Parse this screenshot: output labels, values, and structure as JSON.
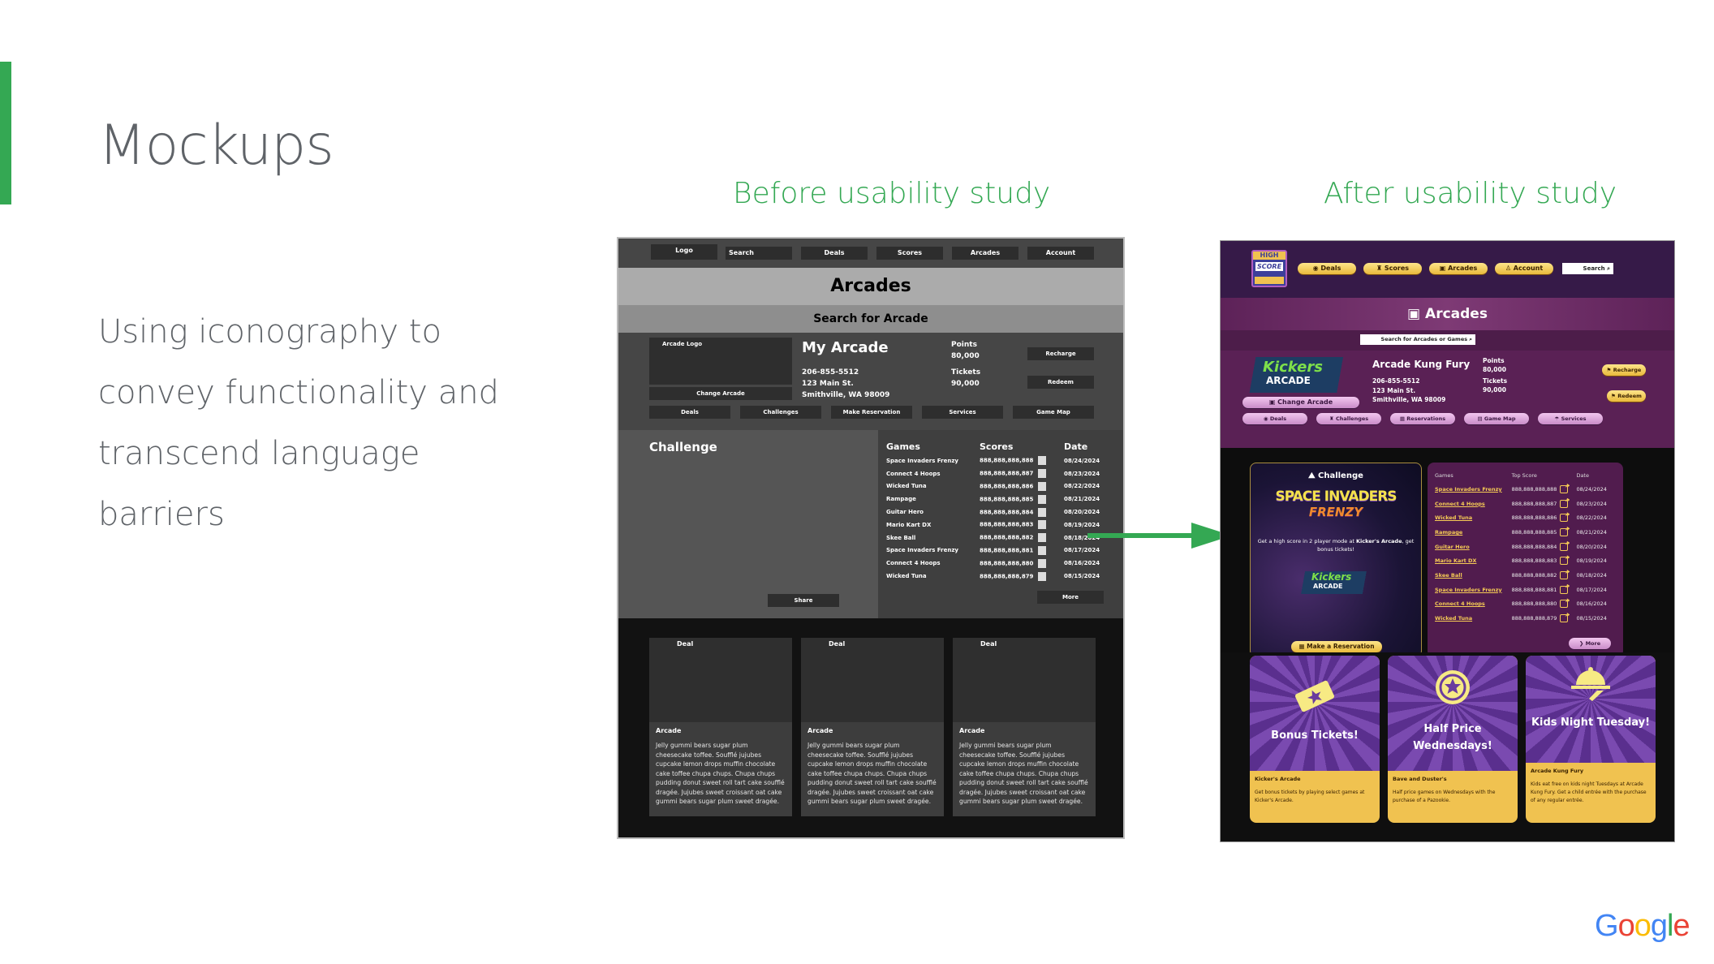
{
  "slide": {
    "title": "Mockups",
    "body": "Using iconography to convey functionality and transcend language barriers",
    "before_heading": "Before usability study",
    "after_heading": "After usability study",
    "brand_logo": "Google",
    "accent_color": "#34a853"
  },
  "before": {
    "nav": {
      "logo": "Logo",
      "search": "Search",
      "deals": "Deals",
      "scores": "Scores",
      "arcades": "Arcades",
      "account": "Account"
    },
    "title": "Arcades",
    "search_label": "Search for Arcade",
    "arcade": {
      "logo_label": "Arcade Logo",
      "change_button": "Change Arcade",
      "name": "My Arcade",
      "phone": "206-855-5512",
      "street": "123 Main St.",
      "city": "Smithville, WA 98009",
      "points_label": "Points",
      "points": "80,000",
      "tickets_label": "Tickets",
      "tickets": "90,000",
      "recharge": "Recharge",
      "redeem": "Redeem"
    },
    "actions": [
      "Deals",
      "Challenges",
      "Make Reservation",
      "Services",
      "Game Map"
    ],
    "challenge": {
      "title": "Challenge",
      "share": "Share"
    },
    "scores": {
      "headers": [
        "Games",
        "Scores",
        "Date"
      ],
      "rows": [
        [
          "Space Invaders Frenzy",
          "888,888,888,888",
          "08/24/2024"
        ],
        [
          "Connect 4 Hoops",
          "888,888,888,887",
          "08/23/2024"
        ],
        [
          "Wicked Tuna",
          "888,888,888,886",
          "08/22/2024"
        ],
        [
          "Rampage",
          "888,888,888,885",
          "08/21/2024"
        ],
        [
          "Guitar Hero",
          "888,888,888,884",
          "08/20/2024"
        ],
        [
          "Mario Kart DX",
          "888,888,888,883",
          "08/19/2024"
        ],
        [
          "Skee Ball",
          "888,888,888,882",
          "08/18/2024"
        ],
        [
          "Space Invaders Frenzy",
          "888,888,888,881",
          "08/17/2024"
        ],
        [
          "Connect 4 Hoops",
          "888,888,888,880",
          "08/16/2024"
        ],
        [
          "Wicked Tuna",
          "888,888,888,879",
          "08/15/2024"
        ]
      ],
      "more": "More"
    },
    "deals": [
      {
        "label": "Deal",
        "arcade": "Arcade",
        "text": "Jelly gummi bears sugar plum cheesecake toffee. Soufflé jujubes cupcake lemon drops muffin chocolate cake toffee chupa chups. Chupa chups pudding donut sweet roll tart cake soufflé dragée. Jujubes sweet croissant oat cake gummi bears sugar plum sweet dragée."
      },
      {
        "label": "Deal",
        "arcade": "Arcade",
        "text": "Jelly gummi bears sugar plum cheesecake toffee. Soufflé jujubes cupcake lemon drops muffin chocolate cake toffee chupa chups. Chupa chups pudding donut sweet roll tart cake soufflé dragée. Jujubes sweet croissant oat cake gummi bears sugar plum sweet dragée."
      },
      {
        "label": "Deal",
        "arcade": "Arcade",
        "text": "Jelly gummi bears sugar plum cheesecake toffee. Soufflé jujubes cupcake lemon drops muffin chocolate cake toffee chupa chups. Chupa chups pudding donut sweet roll tart cake soufflé dragée. Jujubes sweet croissant oat cake gummi bears sugar plum sweet dragée."
      }
    ]
  },
  "after": {
    "logo": {
      "line1": "HIGH",
      "line2": "SCORE"
    },
    "nav": {
      "deals": "Deals",
      "scores": "Scores",
      "arcades": "Arcades",
      "account": "Account",
      "search_placeholder": "Search"
    },
    "title": "Arcades",
    "search_placeholder": "Search for Arcades or Games",
    "arcade": {
      "logo_line1": "Kickers",
      "logo_line2": "ARCADE",
      "change_button": "Change Arcade",
      "name": "Arcade Kung Fury",
      "phone": "206-855-5512",
      "street": "123 Main St.",
      "city": "Smithville, WA 98009",
      "points_label": "Points",
      "points": "80,000",
      "tickets_label": "Tickets",
      "tickets": "90,000",
      "recharge": "Recharge",
      "redeem": "Redeem"
    },
    "actions": [
      "Deals",
      "Challenges",
      "Reservations",
      "Game Map",
      "Services"
    ],
    "challenge": {
      "title": "Challenge",
      "game_line1": "SPACE INVADERS",
      "game_line2": "FRENZY",
      "text_prefix": "Get a high score in 2 player mode at ",
      "text_bold": "Kicker's Arcade",
      "text_suffix": ", get bonus tickets!",
      "logo_line1": "Kickers",
      "logo_line2": "ARCADE",
      "reserve_button": "Make a Reservation"
    },
    "scores": {
      "headers": [
        "Games",
        "Top Score",
        "Date"
      ],
      "rows": [
        [
          "Space Invaders Frenzy",
          "888,888,888,888",
          "08/24/2024"
        ],
        [
          "Connect 4 Hoops",
          "888,888,888,887",
          "08/23/2024"
        ],
        [
          "Wicked Tuna",
          "888,888,888,886",
          "08/22/2024"
        ],
        [
          "Rampage",
          "888,888,888,885",
          "08/21/2024"
        ],
        [
          "Guitar Hero",
          "888,888,888,884",
          "08/20/2024"
        ],
        [
          "Mario Kart DX",
          "888,888,888,883",
          "08/19/2024"
        ],
        [
          "Skee Ball",
          "888,888,888,882",
          "08/18/2024"
        ],
        [
          "Space Invaders Frenzy",
          "888,888,888,881",
          "08/17/2024"
        ],
        [
          "Connect 4 Hoops",
          "888,888,888,880",
          "08/16/2024"
        ],
        [
          "Wicked Tuna",
          "888,888,888,879",
          "08/15/2024"
        ]
      ],
      "more": "More"
    },
    "deals": [
      {
        "title": "Bonus Tickets!",
        "icon": "ticket-icon",
        "arcade": "Kicker's Arcade",
        "text": "Get bonus tickets by playing select games at Kicker's Arcade."
      },
      {
        "title": "Half Price Wednesdays!",
        "icon": "star-coin-icon",
        "arcade": "Bave and Duster's",
        "text": "Half price games on Wednesdays with the purchase of a Pazookie."
      },
      {
        "title": "Kids Night Tuesday!",
        "icon": "serving-cloche-icon",
        "arcade": "Arcade Kung Fury",
        "text": "Kids eat free on kids night Tuesdays at Arcade Kung Fury. Get a child entrée with the purchase of any regular entrée."
      }
    ],
    "colors": {
      "header": "#361a48",
      "accent_yellow": "#f0c250",
      "card_purple": "#511c4e"
    }
  }
}
